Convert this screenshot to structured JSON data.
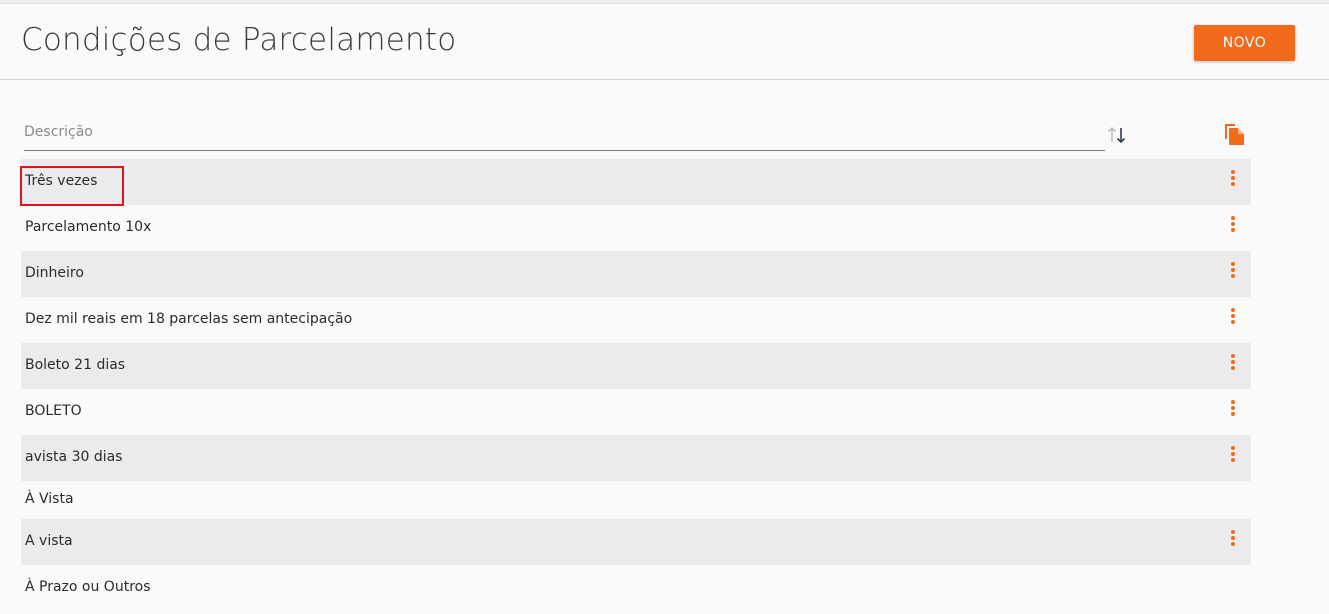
{
  "header": {
    "title": "Condições de Parcelamento",
    "new_button_label": "NOVO"
  },
  "filter": {
    "placeholder": "Descrição",
    "value": ""
  },
  "icons": {
    "sort": "sort-up-down-icon",
    "copy": "copy-document-icon",
    "row_menu": "more-vertical-icon"
  },
  "colors": {
    "accent": "#f26a1b",
    "row_alt": "#ebebed",
    "highlight": "#e0141e"
  },
  "rows": [
    {
      "label": "Três vezes",
      "has_menu": true,
      "highlighted": true
    },
    {
      "label": "Parcelamento 10x",
      "has_menu": true
    },
    {
      "label": "Dinheiro",
      "has_menu": true
    },
    {
      "label": "Dez mil reais em 18 parcelas sem antecipação",
      "has_menu": true
    },
    {
      "label": "Boleto 21 dias",
      "has_menu": true
    },
    {
      "label": "BOLETO",
      "has_menu": true
    },
    {
      "label": "avista 30 dias",
      "has_menu": true
    },
    {
      "label": "À Vista",
      "has_menu": false
    },
    {
      "label": "A vista",
      "has_menu": true
    },
    {
      "label": "À Prazo ou Outros",
      "has_menu": false
    }
  ]
}
